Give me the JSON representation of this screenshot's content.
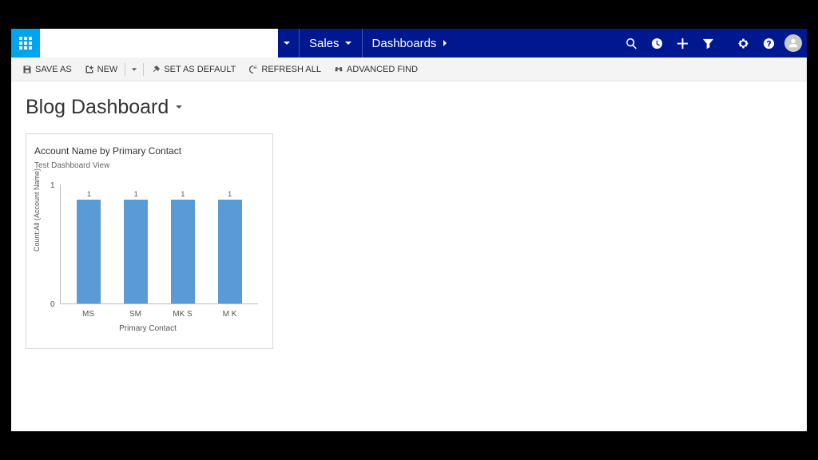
{
  "nav": {
    "area": "Sales",
    "subarea": "Dashboards"
  },
  "cmd": {
    "saveas": "SAVE AS",
    "new": "NEW",
    "setdefault": "SET AS DEFAULT",
    "refresh": "REFRESH ALL",
    "advfind": "ADVANCED FIND"
  },
  "page": {
    "title": "Blog Dashboard"
  },
  "card": {
    "title": "Account Name by Primary Contact",
    "subtitle": "Test Dashboard View"
  },
  "chart_data": {
    "type": "bar",
    "categories": [
      "MS",
      "SM",
      "MK S",
      "M K"
    ],
    "values": [
      1,
      1,
      1,
      1
    ],
    "title": "Account Name by Primary Contact",
    "xlabel": "Primary Contact",
    "ylabel": "Count:All (Account Name)",
    "ylim": [
      0,
      1
    ],
    "yticks": [
      0,
      1
    ]
  }
}
